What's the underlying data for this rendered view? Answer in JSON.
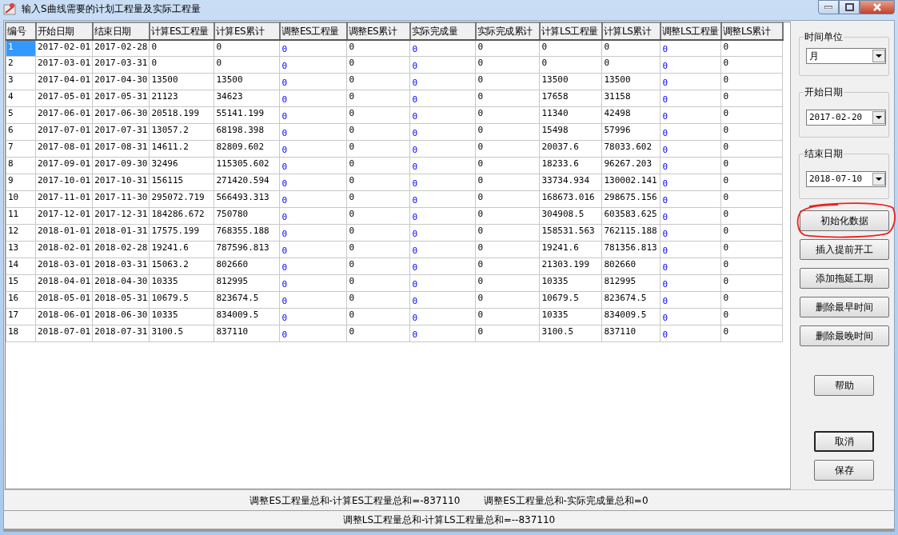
{
  "window": {
    "title": "输入S曲线需要的计划工程量及实际工程量"
  },
  "table": {
    "columns": [
      {
        "label": "编号",
        "kind": "text"
      },
      {
        "label": "开始日期",
        "kind": "text"
      },
      {
        "label": "结束日期",
        "kind": "text"
      },
      {
        "label": "计算ES工程量",
        "kind": "text"
      },
      {
        "label": "计算ES累计",
        "kind": "text"
      },
      {
        "label": "调整ES工程量",
        "kind": "input"
      },
      {
        "label": "调整ES累计",
        "kind": "text"
      },
      {
        "label": "实际完成量",
        "kind": "input"
      },
      {
        "label": "实际完成累计",
        "kind": "text"
      },
      {
        "label": "计算LS工程量",
        "kind": "text"
      },
      {
        "label": "计算LS累计",
        "kind": "text"
      },
      {
        "label": "调整LS工程量",
        "kind": "input"
      },
      {
        "label": "调整LS累计",
        "kind": "text"
      }
    ],
    "rows": [
      {
        "selected": true,
        "cells": [
          "1",
          "2017-02-01",
          "2017-02-28",
          "0",
          "0",
          "0",
          "0",
          "0",
          "0",
          "0",
          "0",
          "0",
          "0"
        ]
      },
      {
        "selected": false,
        "cells": [
          "2",
          "2017-03-01",
          "2017-03-31",
          "0",
          "0",
          "0",
          "0",
          "0",
          "0",
          "0",
          "0",
          "0",
          "0"
        ]
      },
      {
        "selected": false,
        "cells": [
          "3",
          "2017-04-01",
          "2017-04-30",
          "13500",
          "13500",
          "0",
          "0",
          "0",
          "0",
          "13500",
          "13500",
          "0",
          "0"
        ]
      },
      {
        "selected": false,
        "cells": [
          "4",
          "2017-05-01",
          "2017-05-31",
          "21123",
          "34623",
          "0",
          "0",
          "0",
          "0",
          "17658",
          "31158",
          "0",
          "0"
        ]
      },
      {
        "selected": false,
        "cells": [
          "5",
          "2017-06-01",
          "2017-06-30",
          "20518.199",
          "55141.199",
          "0",
          "0",
          "0",
          "0",
          "11340",
          "42498",
          "0",
          "0"
        ]
      },
      {
        "selected": false,
        "cells": [
          "6",
          "2017-07-01",
          "2017-07-31",
          "13057.2",
          "68198.398",
          "0",
          "0",
          "0",
          "0",
          "15498",
          "57996",
          "0",
          "0"
        ]
      },
      {
        "selected": false,
        "cells": [
          "7",
          "2017-08-01",
          "2017-08-31",
          "14611.2",
          "82809.602",
          "0",
          "0",
          "0",
          "0",
          "20037.6",
          "78033.602",
          "0",
          "0"
        ]
      },
      {
        "selected": false,
        "cells": [
          "8",
          "2017-09-01",
          "2017-09-30",
          "32496",
          "115305.602",
          "0",
          "0",
          "0",
          "0",
          "18233.6",
          "96267.203",
          "0",
          "0"
        ]
      },
      {
        "selected": false,
        "cells": [
          "9",
          "2017-10-01",
          "2017-10-31",
          "156115",
          "271420.594",
          "0",
          "0",
          "0",
          "0",
          "33734.934",
          "130002.141",
          "0",
          "0"
        ]
      },
      {
        "selected": false,
        "cells": [
          "10",
          "2017-11-01",
          "2017-11-30",
          "295072.719",
          "566493.313",
          "0",
          "0",
          "0",
          "0",
          "168673.016",
          "298675.156",
          "0",
          "0"
        ]
      },
      {
        "selected": false,
        "cells": [
          "11",
          "2017-12-01",
          "2017-12-31",
          "184286.672",
          "750780",
          "0",
          "0",
          "0",
          "0",
          "304908.5",
          "603583.625",
          "0",
          "0"
        ]
      },
      {
        "selected": false,
        "cells": [
          "12",
          "2018-01-01",
          "2018-01-31",
          "17575.199",
          "768355.188",
          "0",
          "0",
          "0",
          "0",
          "158531.563",
          "762115.188",
          "0",
          "0"
        ]
      },
      {
        "selected": false,
        "cells": [
          "13",
          "2018-02-01",
          "2018-02-28",
          "19241.6",
          "787596.813",
          "0",
          "0",
          "0",
          "0",
          "19241.6",
          "781356.813",
          "0",
          "0"
        ]
      },
      {
        "selected": false,
        "cells": [
          "14",
          "2018-03-01",
          "2018-03-31",
          "15063.2",
          "802660",
          "0",
          "0",
          "0",
          "0",
          "21303.199",
          "802660",
          "0",
          "0"
        ]
      },
      {
        "selected": false,
        "cells": [
          "15",
          "2018-04-01",
          "2018-04-30",
          "10335",
          "812995",
          "0",
          "0",
          "0",
          "0",
          "10335",
          "812995",
          "0",
          "0"
        ]
      },
      {
        "selected": false,
        "cells": [
          "16",
          "2018-05-01",
          "2018-05-31",
          "10679.5",
          "823674.5",
          "0",
          "0",
          "0",
          "0",
          "10679.5",
          "823674.5",
          "0",
          "0"
        ]
      },
      {
        "selected": false,
        "cells": [
          "17",
          "2018-06-01",
          "2018-06-30",
          "10335",
          "834009.5",
          "0",
          "0",
          "0",
          "0",
          "10335",
          "834009.5",
          "0",
          "0"
        ]
      },
      {
        "selected": false,
        "cells": [
          "18",
          "2018-07-01",
          "2018-07-31",
          "3100.5",
          "837110",
          "0",
          "0",
          "0",
          "0",
          "3100.5",
          "837110",
          "0",
          "0"
        ]
      }
    ]
  },
  "side_panel": {
    "fields": [
      {
        "label": "时间单位",
        "value": "月",
        "kind": "unit"
      },
      {
        "label": "开始日期",
        "value": "2017-02-20",
        "kind": "date"
      },
      {
        "label": "结束日期",
        "value": "2018-07-10",
        "kind": "date"
      }
    ],
    "buttons": [
      {
        "label": "初始化数据",
        "kind": "action",
        "default": false,
        "circled": true
      },
      {
        "label": "插入提前开工",
        "kind": "action",
        "default": false,
        "circled": false
      },
      {
        "label": "添加拖延工期",
        "kind": "action",
        "default": false,
        "circled": false
      },
      {
        "label": "删除最早时间",
        "kind": "action",
        "default": false,
        "circled": false
      },
      {
        "label": "删除最晚时间",
        "kind": "action",
        "default": false,
        "circled": false
      },
      {
        "label": "帮助",
        "kind": "help",
        "default": false,
        "circled": false
      },
      {
        "label": "取消",
        "kind": "dialog",
        "default": true,
        "circled": false
      },
      {
        "label": "保存",
        "kind": "dialog",
        "default": false,
        "circled": false
      }
    ]
  },
  "status_bar": [
    {
      "texts": [
        "调整ES工程量总和-计算ES工程量总和=-837110",
        "调整ES工程量总和-实际完成量总和=0"
      ]
    },
    {
      "texts": [
        "调整LS工程量总和-计算LS工程量总和=--837110"
      ]
    }
  ]
}
